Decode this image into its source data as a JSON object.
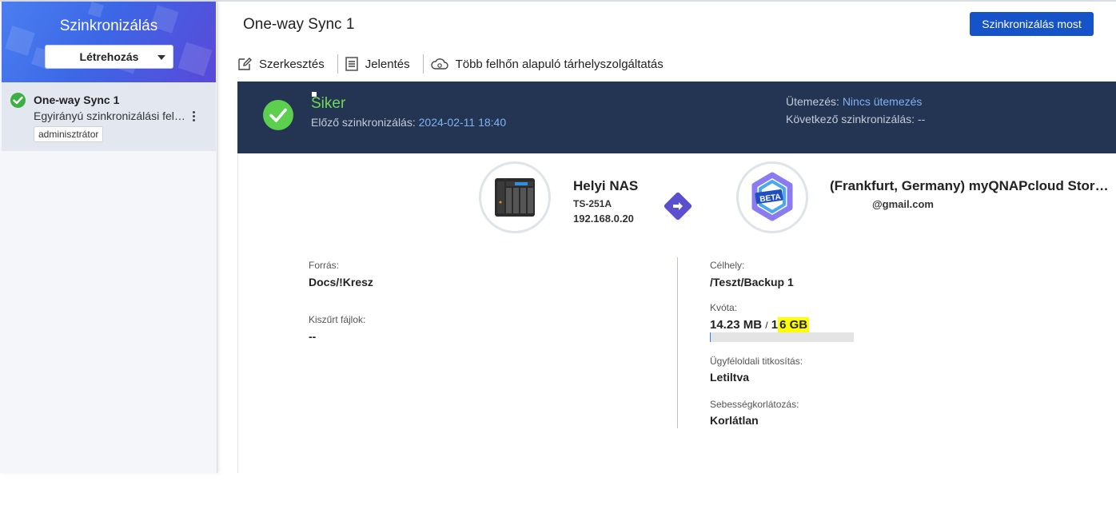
{
  "sidebar": {
    "title": "Szinkronizálás",
    "create_label": "Létrehozás",
    "job": {
      "name": "One-way Sync 1",
      "description": "Egyirányú szinkronizálási feladat",
      "user": "adminisztrátor"
    }
  },
  "header": {
    "title": "One-way Sync 1",
    "sync_now_label": "Szinkronizálás most"
  },
  "toolbar": {
    "edit_label": "Szerkesztés",
    "report_label": "Jelentés",
    "multicloud_label": "Több felhőn alapuló tárhelyszolgáltatás"
  },
  "status": {
    "result": "Siker",
    "prev_sync_label": "Előző szinkronizálás:",
    "prev_sync_value": "2024-02-11 18:40",
    "schedule_label": "Ütemezés:",
    "schedule_value": "Nincs ütemezés",
    "next_sync_label": "Következő szinkronizálás:",
    "next_sync_value": "--"
  },
  "source_device": {
    "name": "Helyi NAS",
    "model": "TS-251A",
    "ip": "192.168.0.20"
  },
  "target_device": {
    "name": "(Frankfurt, Germany) myQNAPcloud Storage",
    "account": "@gmail.com",
    "badge": "BETA"
  },
  "details": {
    "source_label": "Forrás:",
    "source_value": "Docs/!Kresz",
    "filtered_label": "Kiszűrt fájlok:",
    "filtered_value": "--",
    "dest_label": "Célhely:",
    "dest_value": "/Teszt/Backup 1",
    "quota_label": "Kvóta:",
    "quota_used": "14.23 MB",
    "quota_sep": "/",
    "quota_total_prefix": "1",
    "quota_total_rest": "6 GB",
    "quota_fraction": 0.0009,
    "encryption_label": "Ügyféloldali titkosítás:",
    "encryption_value": "Letiltva",
    "speed_label": "Sebességkorlátozás:",
    "speed_value": "Korlátlan"
  },
  "colors": {
    "accent": "#1652c8",
    "status_bg": "#243453",
    "success": "#6fd65a",
    "link": "#7fb3f2",
    "highlight": "#ffff00"
  }
}
